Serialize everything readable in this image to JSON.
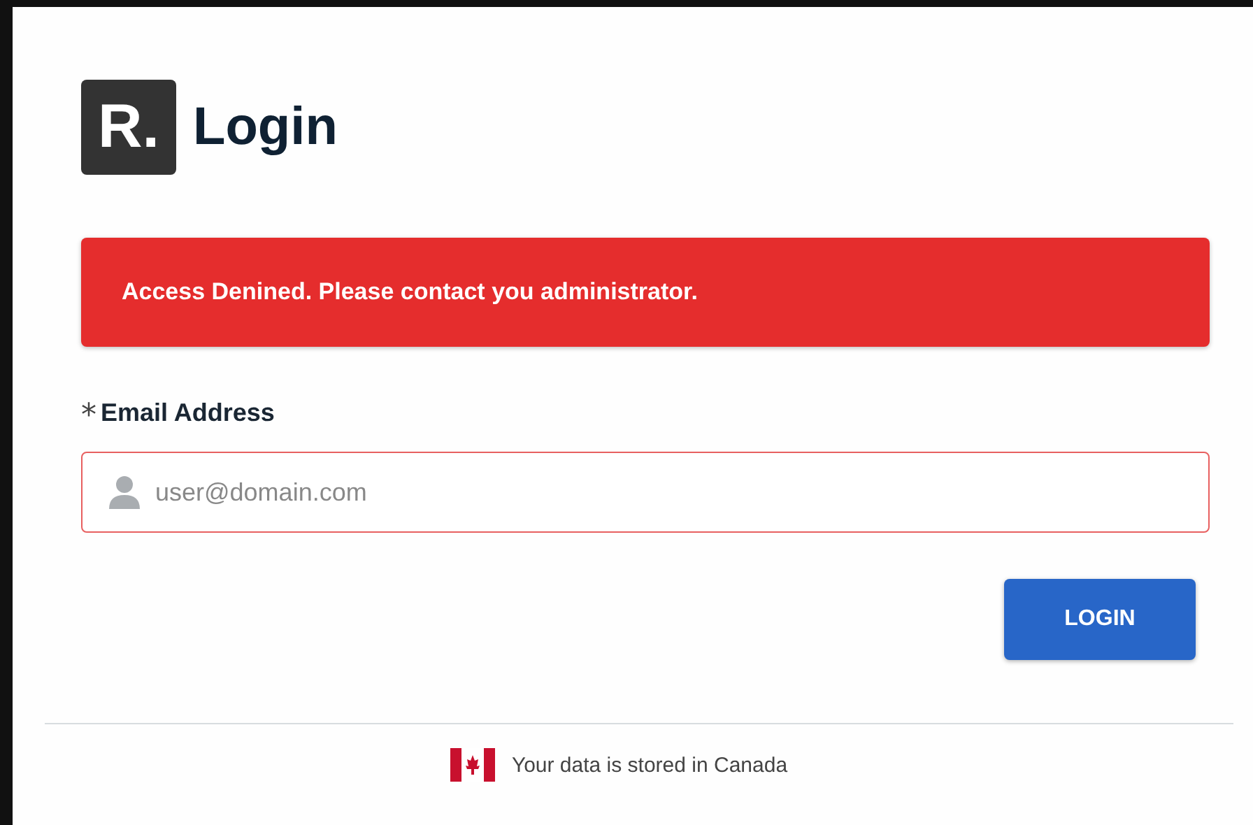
{
  "logo": {
    "text": "R."
  },
  "title": "Login",
  "alert": {
    "message": "Access Denined. Please contact you administrator."
  },
  "email_field": {
    "required_mark": "*",
    "label": "Email Address",
    "placeholder": "user@domain.com",
    "invalid": true
  },
  "login_button": {
    "label": "LOGIN"
  },
  "footer": {
    "text": "Your data is stored in Canada"
  }
}
